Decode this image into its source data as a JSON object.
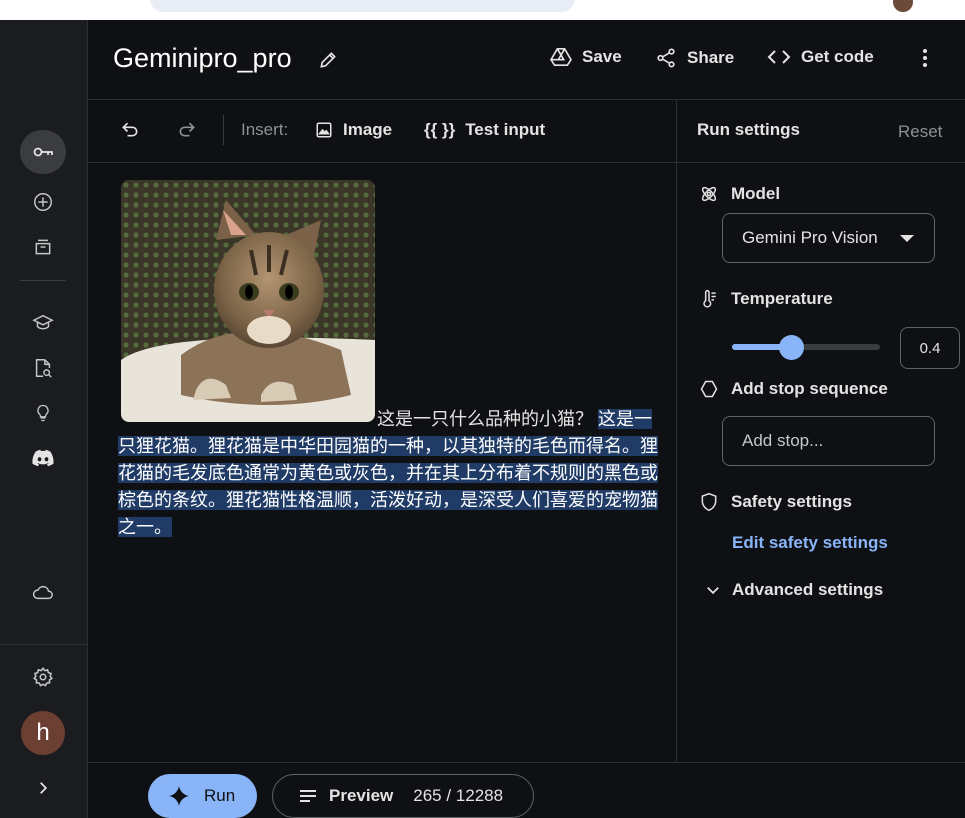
{
  "header": {
    "title": "Geminipro_pro",
    "save_label": "Save",
    "share_label": "Share",
    "get_code_label": "Get code"
  },
  "toolbar": {
    "insert_label": "Insert:",
    "image_label": "Image",
    "test_input_icon": "{{ }}",
    "test_input_label": "Test input"
  },
  "prompt": {
    "question": "这是一只什么品种的小猫？",
    "answer": "这是一只狸花猫。狸花猫是中华田园猫的一种，以其独特的毛色而得名。狸花猫的毛发底色通常为黄色或灰色，并在其上分布着不规则的黑色或棕色的条纹。狸花猫性格温顺，活泼好动，是深受人们喜爱的宠物猫之一。"
  },
  "run_settings": {
    "heading": "Run settings",
    "reset_label": "Reset",
    "model_label": "Model",
    "model_value": "Gemini Pro Vision",
    "temperature_label": "Temperature",
    "temperature_value": "0.4",
    "temperature_fraction": 0.4,
    "stop_sequence_label": "Add stop sequence",
    "stop_placeholder": "Add stop...",
    "safety_label": "Safety settings",
    "edit_safety_label": "Edit safety settings",
    "advanced_label": "Advanced settings"
  },
  "footer": {
    "run_label": "Run",
    "preview_label": "Preview",
    "token_count": "265 / 12288"
  },
  "user": {
    "avatar_initial": "h"
  },
  "colors": {
    "accent": "#8ab4f8",
    "background": "#0e1013",
    "rail": "#1b1c1f",
    "selection": "#1f3b66"
  },
  "icons": [
    "key-icon",
    "add-icon",
    "library-icon",
    "school-icon",
    "doc-search-icon",
    "lightbulb-icon",
    "discord-icon",
    "cloud-icon",
    "gear-icon",
    "chevron-right-icon",
    "pencil-icon",
    "drive-icon",
    "share-icon",
    "code-icon",
    "more-vert-icon",
    "undo-icon",
    "redo-icon",
    "image-icon",
    "model-icon",
    "thermometer-icon",
    "hexagon-icon",
    "shield-icon",
    "chevron-down-icon",
    "sparkle-icon",
    "lines-icon"
  ]
}
